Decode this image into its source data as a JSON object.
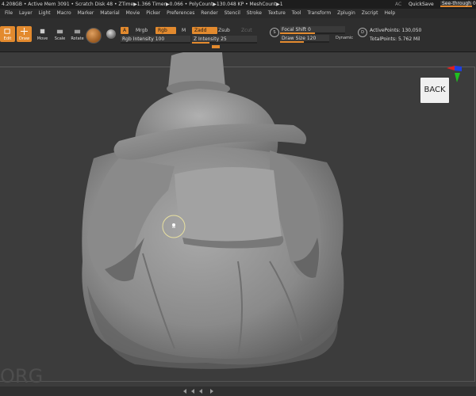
{
  "status": {
    "info": "4.208GB • Active Mem 3091 • Scratch Disk 48 • ZTime▶1.366 Timer▶0.066 • PolyCount▶130.048 KP • MeshCount▶1",
    "ac": "AC",
    "quicksave": "QuickSave",
    "see_through_label": "See-through",
    "see_through_value": "0"
  },
  "menu": [
    "File",
    "Layer",
    "Light",
    "Macro",
    "Marker",
    "Material",
    "Movie",
    "Picker",
    "Preferences",
    "Render",
    "Stencil",
    "Stroke",
    "Texture",
    "Tool",
    "Transform",
    "Zplugin",
    "Zscript",
    "Help"
  ],
  "toolbar": {
    "edit": "Edit",
    "draw": "Draw",
    "move": "Move",
    "scale": "Scale",
    "rotate": "Rotate",
    "a_label": "A",
    "mrgb": "Mrgb",
    "rgb": "Rgb",
    "m": "M",
    "rgb_intensity_label": "Rgb Intensity",
    "rgb_intensity_value": "100",
    "zadd": "Zadd",
    "zsub": "Zsub",
    "zcut": "Zcut",
    "z_intensity_label": "Z Intensity",
    "z_intensity_value": "25",
    "focal_shift_label": "Focal Shift",
    "focal_shift_value": "0",
    "draw_size_label": "Draw Size",
    "draw_size_value": "120",
    "dynamic": "Dynamic",
    "active_points": "ActivePoints: 130,050",
    "total_points": "TotalPoints: 5.762 Mil"
  },
  "viewport": {
    "back_label": "BACK",
    "watermark": "ORG",
    "axis_colors": {
      "x": "#e02020",
      "y": "#20c020",
      "z": "#2040e0"
    }
  }
}
